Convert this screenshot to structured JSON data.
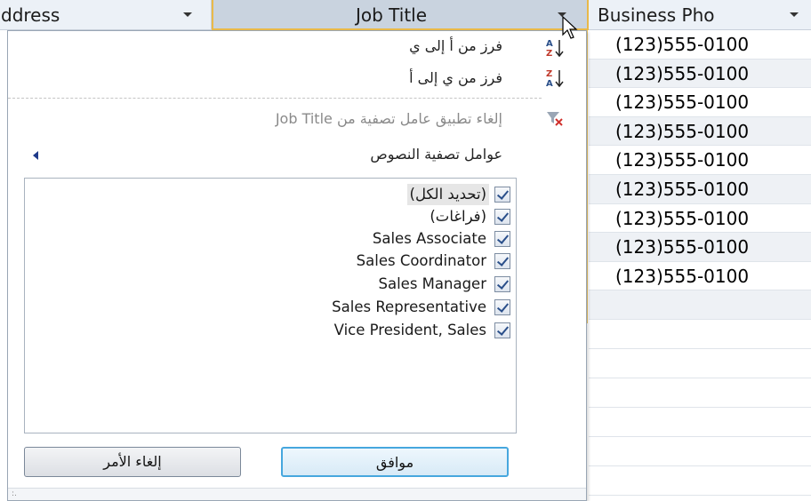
{
  "headers": {
    "address": "ddress",
    "job_title": "Job Title",
    "business_phone": "Business Pho"
  },
  "phone_rows": [
    "(123)555-0100",
    "(123)555-0100",
    "(123)555-0100",
    "(123)555-0100",
    "(123)555-0100",
    "(123)555-0100",
    "(123)555-0100",
    "(123)555-0100",
    "(123)555-0100"
  ],
  "popup": {
    "menu": {
      "sort_asc": "فرز من أ إلى ي",
      "sort_desc": "فرز من ي إلى أ",
      "clear_filter": "إلغاء تطبيق عامل تصفية من Job Title",
      "text_filters": "عوامل تصفية النصوص"
    },
    "list": {
      "select_all": "(تحديد الكل)",
      "blanks": "(فراغات)",
      "items": [
        "Sales Associate",
        "Sales Coordinator",
        "Sales Manager",
        "Sales Representative",
        "Vice President, Sales"
      ]
    },
    "buttons": {
      "ok": "موافق",
      "cancel": "إلغاء الأمر"
    },
    "resize_grip": ":."
  },
  "colors": {
    "header_bg": "#ecf1f7",
    "active_header_bg": "#c9d3df",
    "active_border": "#e9b949",
    "ok_border": "#46a7de"
  }
}
